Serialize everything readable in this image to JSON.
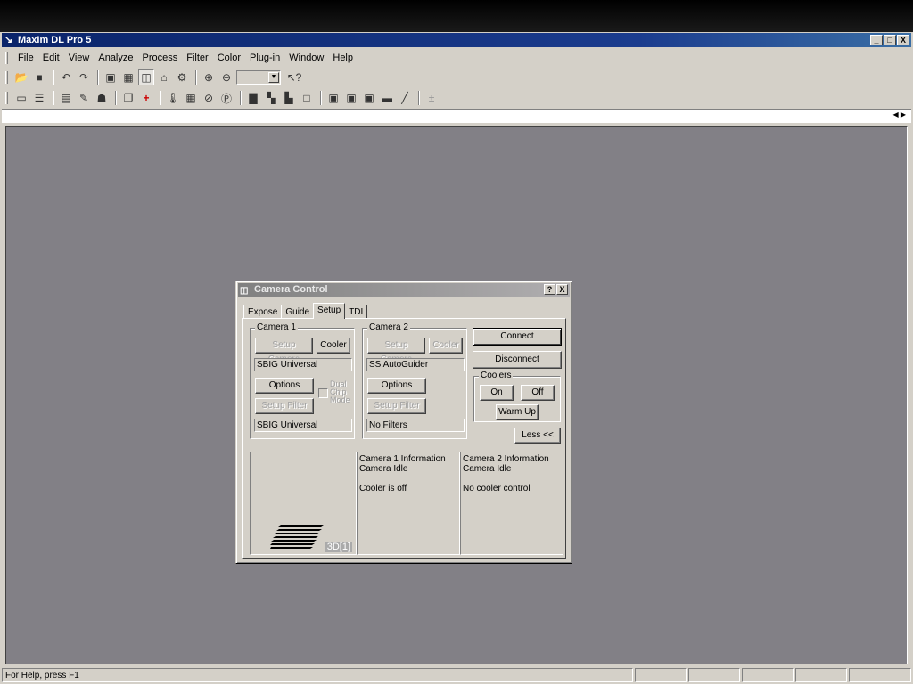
{
  "window": {
    "title": "MaxIm DL Pro 5",
    "caption_buttons": [
      "_",
      "□",
      "X"
    ]
  },
  "menu": [
    {
      "label": "File",
      "key": "F"
    },
    {
      "label": "Edit",
      "key": "E"
    },
    {
      "label": "View",
      "key": "V"
    },
    {
      "label": "Analyze",
      "key": "A"
    },
    {
      "label": "Process",
      "key": "P"
    },
    {
      "label": "Filter",
      "key": "t"
    },
    {
      "label": "Color",
      "key": "C"
    },
    {
      "label": "Plug-in",
      "key": "u"
    },
    {
      "label": "Window",
      "key": "W"
    },
    {
      "label": "Help",
      "key": "H"
    }
  ],
  "toolbar1": [
    "open-icon",
    "save-icon",
    "undo-icon",
    "redo-icon",
    "image-icon",
    "screen-stretch-icon",
    "camera-control-icon",
    "observatory-icon",
    "settings-icon",
    "zoom-in-icon",
    "zoom-out-icon",
    "help-context-icon"
  ],
  "toolbar2": [
    "ruler-icon",
    "stack-icon",
    "analyze-icon",
    "calibrate-icon",
    "process-icon",
    "copy-icon",
    "crosshair-icon",
    "thermometer-icon",
    "grid-icon",
    "filter-wheel-icon",
    "filter-icon",
    "histogram-icon",
    "levels-icon",
    "curves-icon",
    "crop-icon",
    "bin-icon",
    "flip-icon",
    "rotate-icon",
    "line-icon",
    "curve-icon",
    "plusminus-icon"
  ],
  "status": {
    "text": "For Help, press F1"
  },
  "dialog": {
    "title": "Camera Control",
    "help_btn": "?",
    "close_btn": "X",
    "tabs": [
      "Expose",
      "Guide",
      "Setup",
      "TDI"
    ],
    "active_tab": "Setup",
    "camera1": {
      "legend": "Camera 1",
      "setup_camera": "Setup Camera",
      "cooler": "Cooler",
      "model": "SBIG Universal",
      "options": "Options",
      "dual_chip": "Dual Chip Mode",
      "setup_filter": "Setup Filter",
      "filter_model": "SBIG Universal"
    },
    "camera2": {
      "legend": "Camera 2",
      "setup_camera": "Setup Camera",
      "cooler": "Cooler",
      "model": "SS AutoGuider",
      "options": "Options",
      "setup_filter": "Setup Filter",
      "filter_model": "No Filters"
    },
    "connect": "Connect",
    "disconnect": "Disconnect",
    "coolers": {
      "legend": "Coolers",
      "on": "On",
      "off": "Off",
      "warm_up": "Warm Up"
    },
    "less": "Less <<",
    "preview_logo": "3D[1]",
    "info1": {
      "title": "Camera 1 Information",
      "state": "Camera Idle",
      "cooler": "Cooler is off"
    },
    "info2": {
      "title": "Camera 2 Information",
      "state": "Camera Idle",
      "cooler": "No cooler control"
    }
  }
}
